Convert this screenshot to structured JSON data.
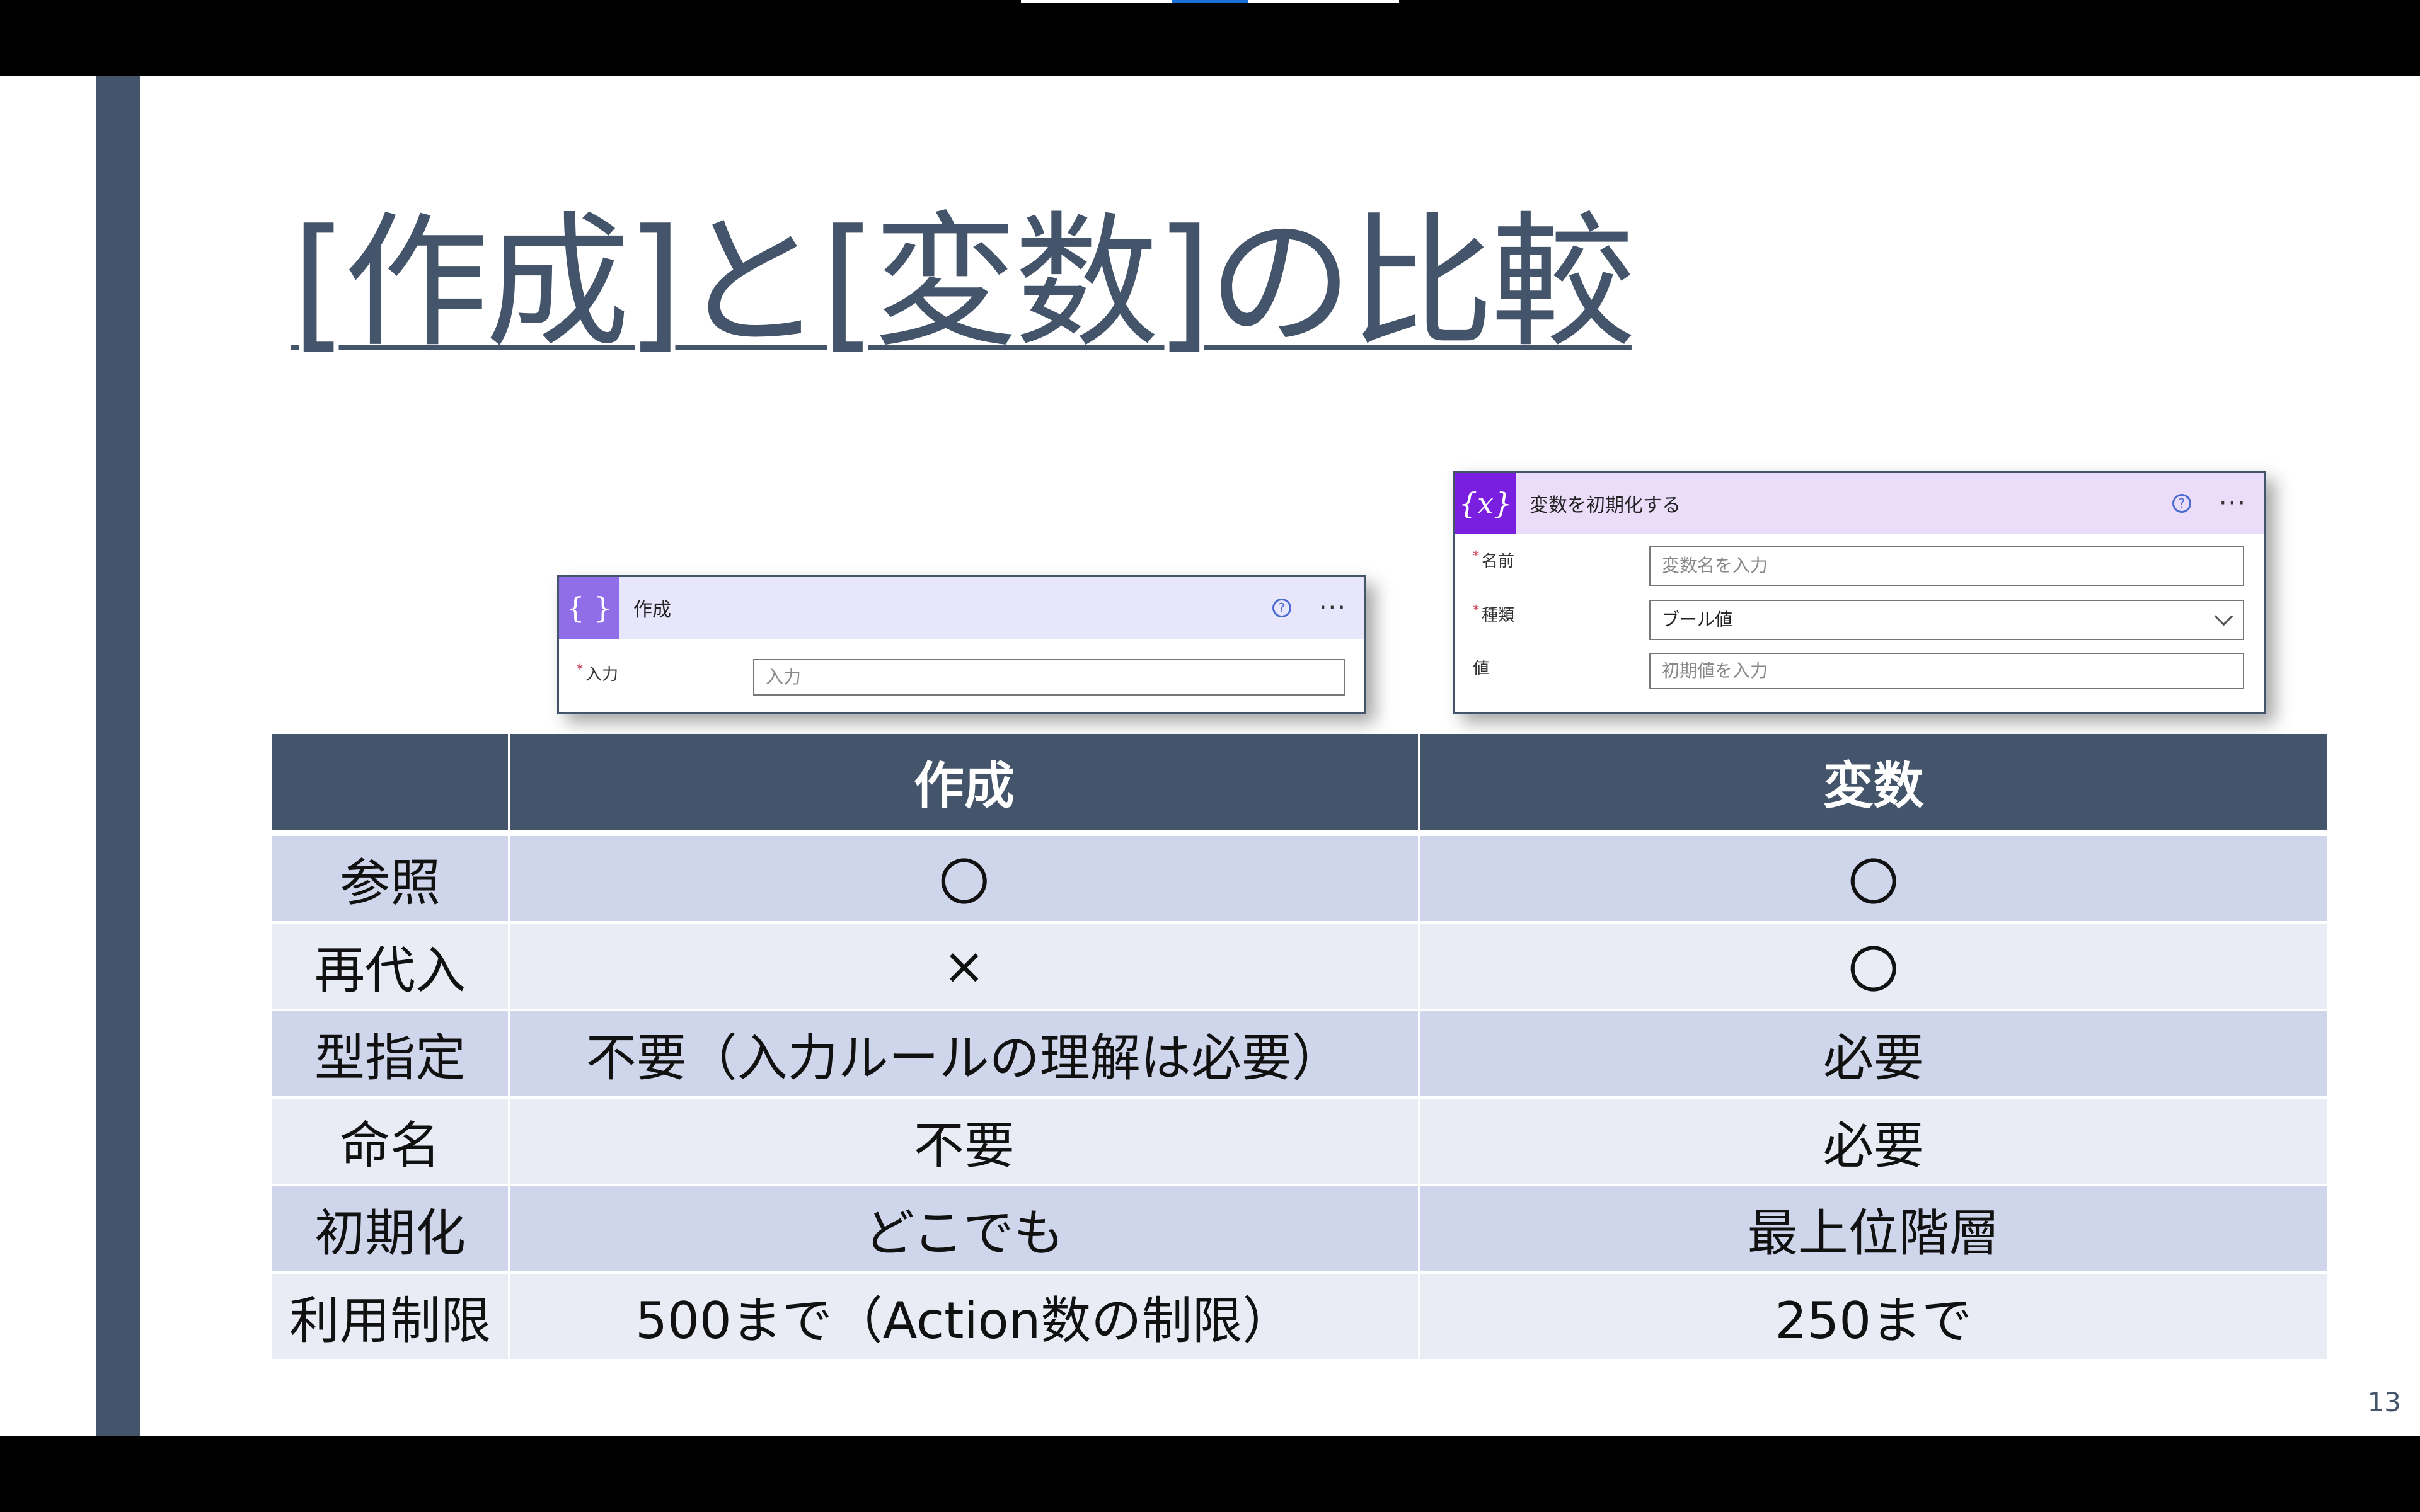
{
  "slide": {
    "title": "[作成]と[変数]の比較",
    "page_number": "13"
  },
  "compose_card": {
    "icon": "compose-braces-icon",
    "icon_glyph": "{ }",
    "title": "作成",
    "help_glyph": "?",
    "more_glyph": "···",
    "fields": [
      {
        "label": "入力",
        "required": true,
        "placeholder": "入力"
      }
    ]
  },
  "variable_card": {
    "icon": "variable-x-icon",
    "icon_glyph": "{x}",
    "title": "変数を初期化する",
    "help_glyph": "?",
    "more_glyph": "···",
    "fields": [
      {
        "label": "名前",
        "required": true,
        "placeholder": "変数名を入力"
      },
      {
        "label": "種類",
        "required": true,
        "value": "ブール値"
      },
      {
        "label": "値",
        "required": false,
        "placeholder": "初期値を入力"
      }
    ]
  },
  "table": {
    "headers": [
      "",
      "作成",
      "変数"
    ],
    "rows": [
      [
        "参照",
        "〇",
        "〇"
      ],
      [
        "再代入",
        "×",
        "〇"
      ],
      [
        "型指定",
        "不要（入力ルールの理解は必要）",
        "必要"
      ],
      [
        "命名",
        "不要",
        "必要"
      ],
      [
        "初期化",
        "どこでも",
        "最上位階層"
      ],
      [
        "利用制限",
        "500まで（Action数の制限）",
        "250まで"
      ]
    ]
  },
  "colors": {
    "accent": "#44546a",
    "row_odd": "#cfd5ea",
    "row_even": "#e9ebf5",
    "compose_icon": "#8f6ee8",
    "variable_icon": "#7a1fe0"
  }
}
